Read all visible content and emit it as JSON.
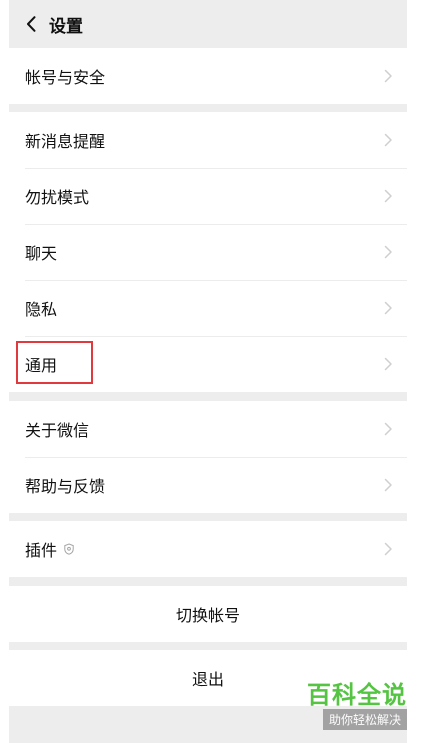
{
  "header": {
    "title": "设置"
  },
  "groups": [
    {
      "items": [
        {
          "label": "帐号与安全"
        }
      ]
    },
    {
      "items": [
        {
          "label": "新消息提醒"
        },
        {
          "label": "勿扰模式"
        },
        {
          "label": "聊天"
        },
        {
          "label": "隐私"
        },
        {
          "label": "通用"
        }
      ]
    },
    {
      "items": [
        {
          "label": "关于微信"
        },
        {
          "label": "帮助与反馈"
        }
      ]
    },
    {
      "items": [
        {
          "label": "插件"
        }
      ]
    }
  ],
  "actions": {
    "switch_account": "切换帐号",
    "logout": "退出"
  },
  "watermark": {
    "title": "百科全说",
    "subtitle": "助你轻松解决"
  },
  "colors": {
    "background": "#ededed",
    "highlight": "#e0393e",
    "watermark_green": "#56c443"
  }
}
